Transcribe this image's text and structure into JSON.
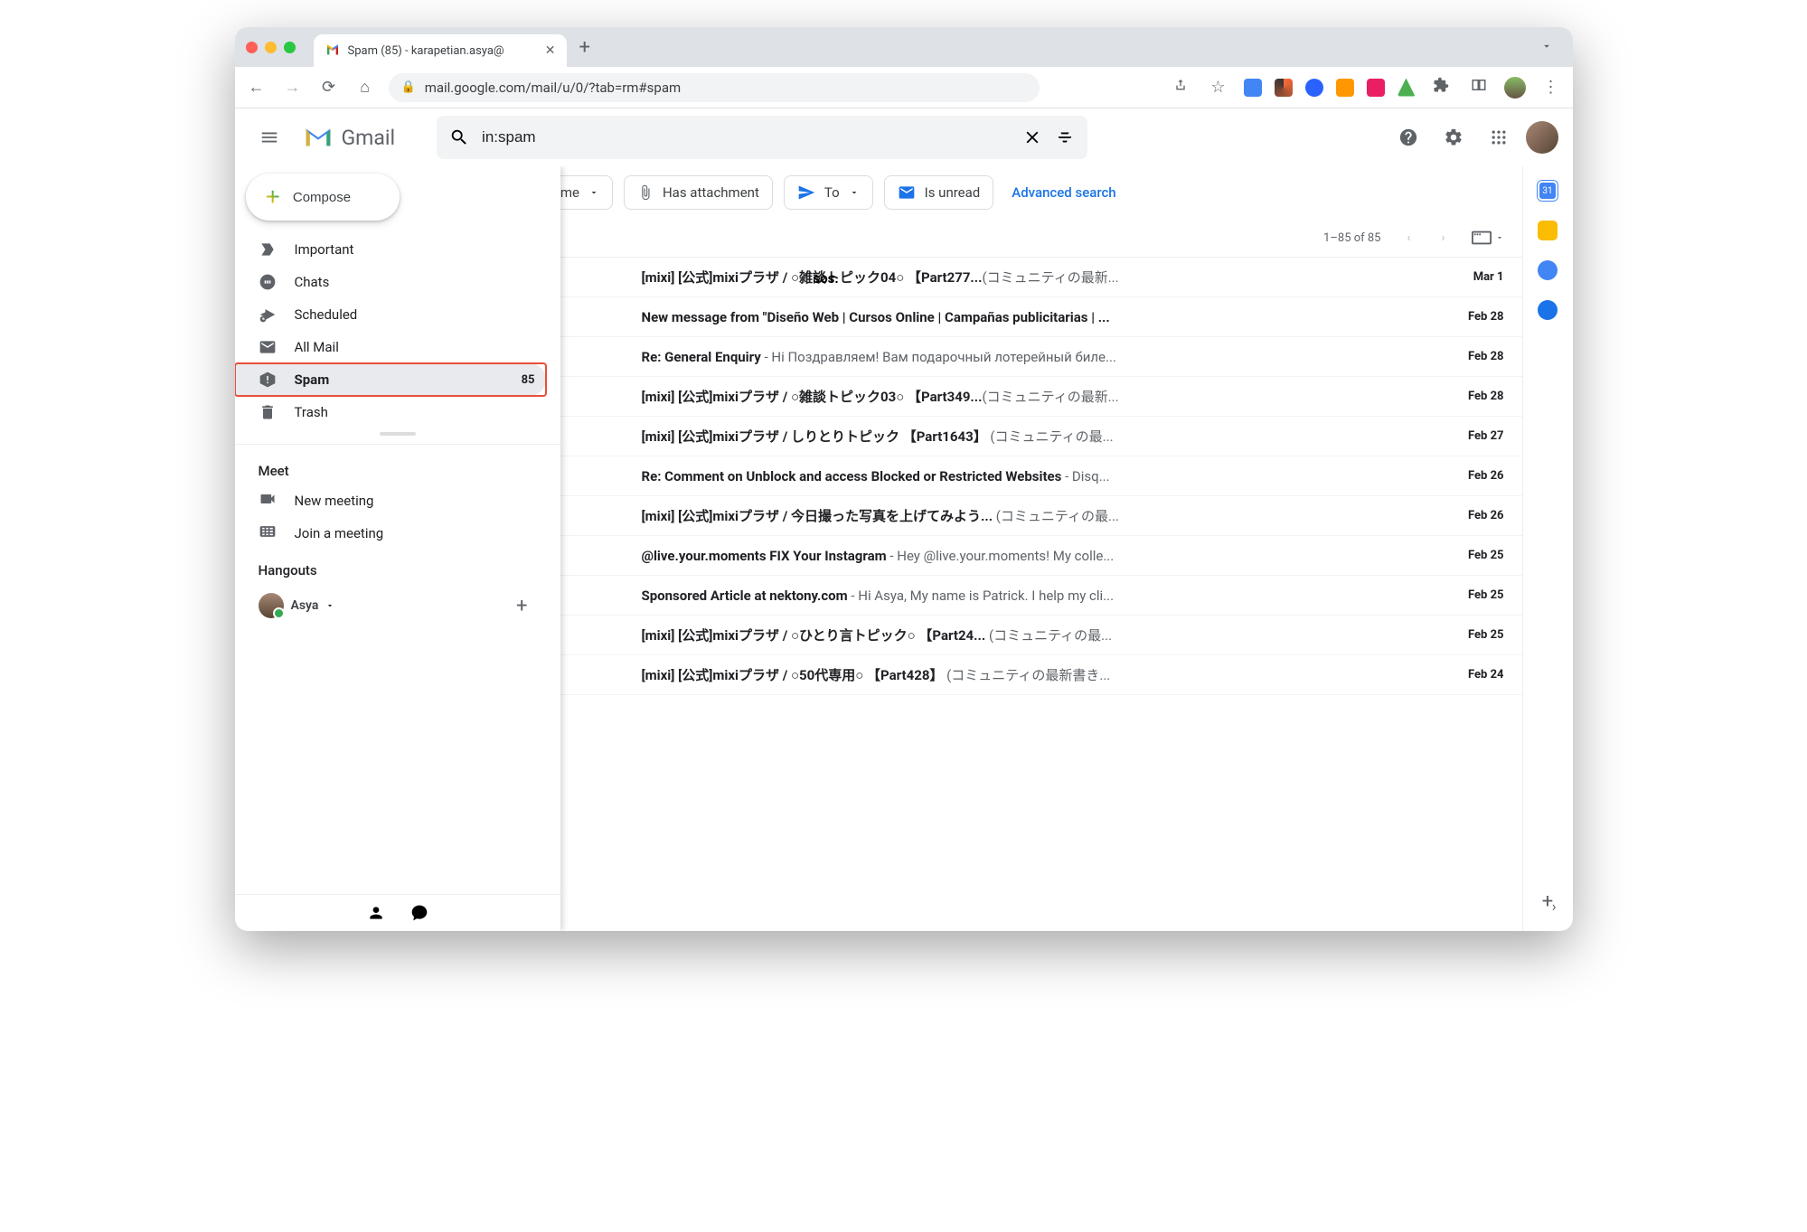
{
  "browser": {
    "tab_title": "Spam (85) - karapetian.asya@",
    "url": "mail.google.com/mail/u/0/?tab=rm#spam"
  },
  "header": {
    "logo_text": "Gmail",
    "search_value": "in:spam"
  },
  "compose_label": "Compose",
  "sidebar": {
    "folders": [
      {
        "icon": "important",
        "label": "Important",
        "count": ""
      },
      {
        "icon": "chats",
        "label": "Chats",
        "count": ""
      },
      {
        "icon": "scheduled",
        "label": "Scheduled",
        "count": ""
      },
      {
        "icon": "allmail",
        "label": "All Mail",
        "count": ""
      },
      {
        "icon": "spam",
        "label": "Spam",
        "count": "85",
        "selected": true
      },
      {
        "icon": "trash",
        "label": "Trash",
        "count": ""
      }
    ],
    "meet_label": "Meet",
    "meet_items": [
      {
        "icon": "video",
        "label": "New meeting"
      },
      {
        "icon": "keyboard",
        "label": "Join a meeting"
      }
    ],
    "hangouts_label": "Hangouts",
    "hangouts_user": "Asya"
  },
  "chips": {
    "time": "y time",
    "attachment": "Has attachment",
    "to": "To",
    "unread": "Is unread",
    "advanced": "Advanced search"
  },
  "list_header": {
    "range": "1–85 of 85"
  },
  "row1_sender_fragment": "sos.",
  "messages": [
    {
      "subject": "[mixi] [公式]mixiプラザ / ○雑談トピック04○ 【Part277...",
      "snippet": "(コミュニティの最新...",
      "date": "Mar 1"
    },
    {
      "subject": "New message from \"Diseño Web | Cursos Online | Campañas publicitarias | ...",
      "snippet": "",
      "date": "Feb 28"
    },
    {
      "subject": "Re: General Enquiry",
      "snippet": " - Hi Поздравляем! Вам подарочный лотерейный биле...",
      "date": "Feb 28"
    },
    {
      "subject": "[mixi] [公式]mixiプラザ / ○雑談トピック03○ 【Part349...",
      "snippet": "(コミュニティの最新...",
      "date": "Feb 28"
    },
    {
      "subject": "[mixi] [公式]mixiプラザ / しりとりトピック 【Part1643】",
      "snippet": "  (コミュニティの最...",
      "date": "Feb 27"
    },
    {
      "subject": "Re: Comment on Unblock and access Blocked or Restricted Websites",
      "snippet": " - Disq...",
      "date": "Feb 26"
    },
    {
      "subject": "[mixi] [公式]mixiプラザ / 今日撮った写真を上げてみよう...",
      "snippet": " (コミュニティの最...",
      "date": "Feb 26"
    },
    {
      "subject": "@live.your.moments FIX Your Instagram",
      "snippet": " - Hey @live.your.moments! My colle...",
      "date": "Feb 25"
    },
    {
      "subject": "Sponsored Article at nektony.com",
      "snippet": " - Hi Asya, My name is Patrick. I help my cli...",
      "date": "Feb 25"
    },
    {
      "subject": "[mixi] [公式]mixiプラザ / ○ひとり言トピック○ 【Part24...",
      "snippet": " (コミュニティの最...",
      "date": "Feb 25"
    },
    {
      "subject": "[mixi] [公式]mixiプラザ / ○50代専用○ 【Part428】",
      "snippet": "  (コミュニティの最新書き...",
      "date": "Feb 24"
    }
  ]
}
